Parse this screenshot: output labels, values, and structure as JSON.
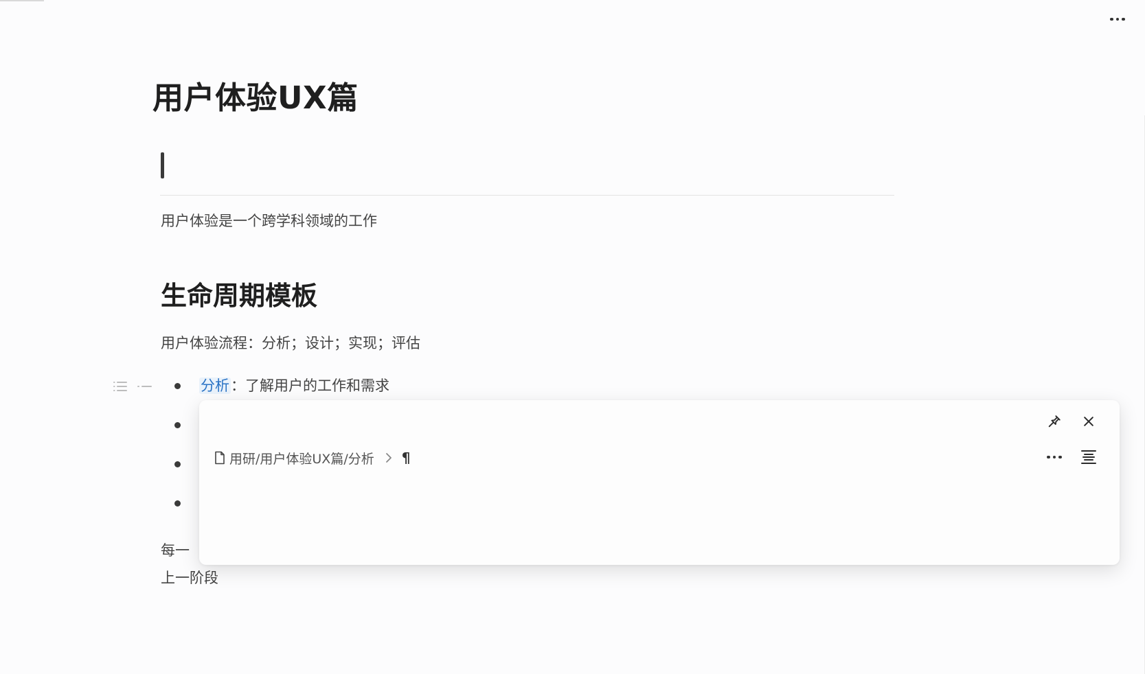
{
  "document": {
    "title": "用户体验UX篇",
    "intro": "用户体验是一个跨学科领域的工作",
    "section_heading": "生命周期模板",
    "process_line": "用户体验流程：分析；设计；实现；评估",
    "list": {
      "item_1_link": "分析",
      "item_1_rest": "：了解用户的工作和需求"
    },
    "para_partial": "每一",
    "para_line_2": "上一阶段"
  },
  "popover": {
    "breadcrumb_path": "用研/用户体验UX篇/分析",
    "pilcrow": "¶"
  },
  "icons": {
    "top_more": "more-horizontal-icon",
    "pin": "pin-icon",
    "close": "close-icon",
    "file": "file-icon",
    "chevron": "chevron-right-icon",
    "pop_more": "more-horizontal-icon",
    "outline": "outline-icon",
    "list_handle": "list-handle-icon",
    "collapse_handle": "collapse-handle-icon"
  },
  "colors": {
    "link": "#2a73c5",
    "link_bg": "#eaf2fb",
    "text": "#444444",
    "heading": "#1f1f1f"
  }
}
